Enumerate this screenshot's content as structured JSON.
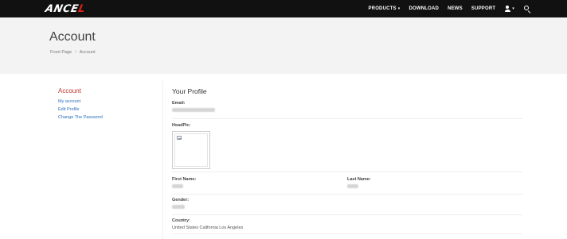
{
  "brand": {
    "logo_main": "ANCE",
    "logo_accent": "L"
  },
  "nav": {
    "products_label": "PRODUCTS",
    "products_caret": "▾",
    "download_label": "DOWNLOAD",
    "news_label": "NEWS",
    "support_label": "SUPPORT",
    "user_caret": "▾"
  },
  "header": {
    "title": "Account",
    "breadcrumb": [
      "Front Page",
      "Account"
    ],
    "breadcrumb_sep": "/"
  },
  "sidebar": {
    "title": "Account",
    "items": [
      {
        "label": "My account"
      },
      {
        "label": "Edit Profile"
      },
      {
        "label": "Change The Password"
      }
    ]
  },
  "profile": {
    "title": "Your Profile",
    "email_label": "Email:",
    "headpic_label": "HeadPic:",
    "first_name_label": "First Name:",
    "last_name_label": "Last Name:",
    "gender_label": "Gender:",
    "country_label": "Country:",
    "country_value": "United States California Los Angeles"
  },
  "colors": {
    "navbar_bg": "#111111",
    "header_bg": "#f3f3f3",
    "accent_red": "#c0392b",
    "link_blue": "#2a6ebb"
  },
  "icons": [
    "user-icon",
    "search-icon",
    "broken-image-icon"
  ]
}
